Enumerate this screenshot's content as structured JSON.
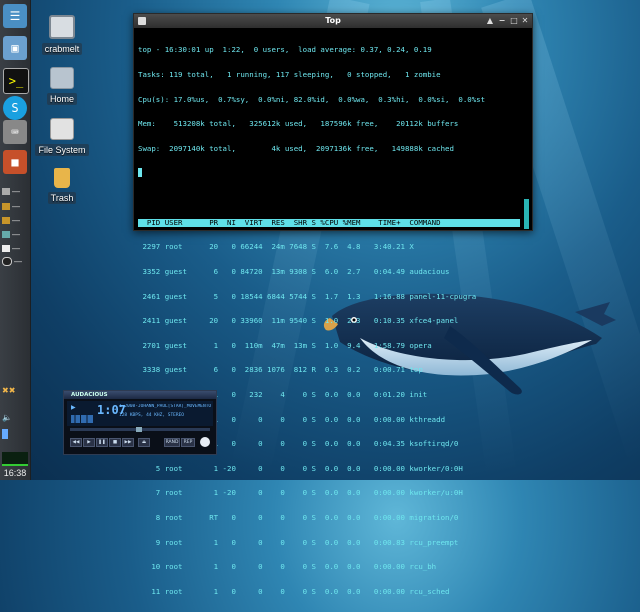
{
  "panel": {
    "clock": "16:38",
    "launchers": [
      "terminal-launcher",
      "window-launcher",
      "shell-launcher",
      "skype-launcher",
      "keyboard-launcher",
      "package-launcher"
    ]
  },
  "desktop": {
    "icons": [
      {
        "label": "crabmelt"
      },
      {
        "label": "Home"
      },
      {
        "label": "File System"
      },
      {
        "label": "Trash"
      }
    ]
  },
  "terminal": {
    "title": "Top",
    "lines": [
      "top - 16:30:01 up  1:22,  0 users,  load average: 0.37, 0.24, 0.19",
      "Tasks: 119 total,   1 running, 117 sleeping,   0 stopped,   1 zombie",
      "Cpu(s): 17.0%us,  0.7%sy,  0.0%ni, 82.0%id,  0.0%wa,  0.3%hi,  0.0%si,  0.0%st",
      "Mem:    513208k total,   325612k used,   187596k free,    20112k buffers",
      "Swap:  2097140k total,        4k used,  2097136k free,   149888k cached"
    ],
    "header": "  PID USER      PR  NI  VIRT  RES  SHR S %CPU %MEM    TIME+  COMMAND",
    "processes": [
      " 2297 root      20   0 66244  24m 7648 S  7.6  4.8   3:40.21 X",
      " 3352 guest      6   0 84720  13m 9308 S  6.0  2.7   0:04.49 audacious",
      " 2461 guest      5   0 18544 6844 5744 S  1.7  1.3   1:16.88 panel-11-cpugra",
      " 2411 guest     20   0 33960  11m 9540 S  1.0  2.3   0:10.35 xfce4-panel",
      " 2701 guest      1   0  110m  47m  13m S  1.0  9.4   1:58.79 opera",
      " 3338 guest      6   0  2836 1076  812 R  0.3  0.2   0:00.71 top",
      "    1 root       1   0   232    4    0 S  0.0  0.0   0:01.20 init",
      "    2 root       1   0     0    0    0 S  0.0  0.0   0:00.00 kthreadd",
      "    3 root       1   0     0    0    0 S  0.0  0.0   0:04.35 ksoftirqd/0",
      "    5 root       1 -20     0    0    0 S  0.0  0.0   0:00.00 kworker/0:0H",
      "    7 root       1 -20     0    0    0 S  0.0  0.0   0:00.00 kworker/u:0H",
      "    8 root      RT   0     0    0    0 S  0.0  0.0   0:00.00 migration/0",
      "    9 root       1   0     0    0    0 S  0.0  0.0   0:00.83 rcu_preempt",
      "   10 root       1   0     0    0    0 S  0.0  0.0   0:00.00 rcu_bh",
      "   11 root       1   0     0    0    0 S  0.0  0.0   0:00.00 rcu_sched"
    ]
  },
  "audacious": {
    "title": "AUDACIOUS",
    "time": "1:07",
    "song": "1-2008-JOHANN_PAUL[STAR]_MOVEMENTO 4",
    "bitrate": "128 KBPS, 44 KHZ, STEREO",
    "shuffle_label": "RAND",
    "repeat_label": "REP"
  },
  "colors": {
    "terminal_text": "#6ee6ee",
    "terminal_header_bg": "#5fe0e8",
    "desktop_bg": "#1a5d8a"
  }
}
